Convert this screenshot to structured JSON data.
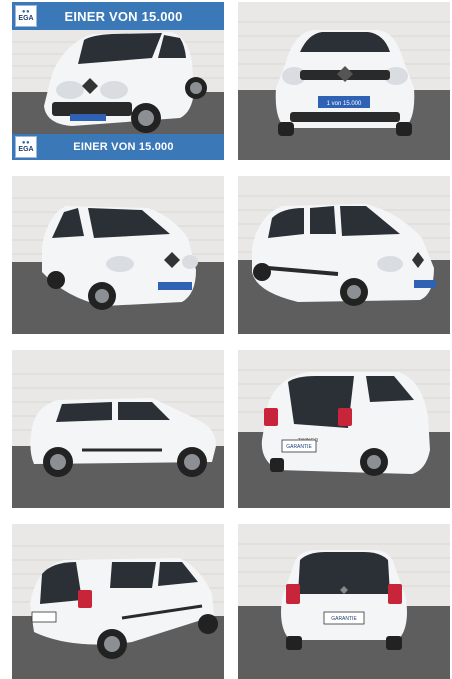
{
  "gallery": {
    "banner": {
      "text": "EINER VON 15.000",
      "logo": "EGA"
    },
    "plate_text_front": "1 von 15.000",
    "plate_text_rear": "GARANTIE",
    "badge_text": "TWINGO",
    "colors": {
      "car_body": "#f4f5f6",
      "window": "#2b3036",
      "wall": "#e9e8e6",
      "floor": "#5f5f5f",
      "banner": "#3a78b8",
      "plate": "#2f62b4"
    },
    "photos": [
      {
        "view": "front-left three-quarter with banners"
      },
      {
        "view": "front"
      },
      {
        "view": "front-left three-quarter"
      },
      {
        "view": "front-right three-quarter"
      },
      {
        "view": "left side profile"
      },
      {
        "view": "rear-right three-quarter"
      },
      {
        "view": "rear-left three-quarter"
      },
      {
        "view": "rear"
      }
    ]
  }
}
